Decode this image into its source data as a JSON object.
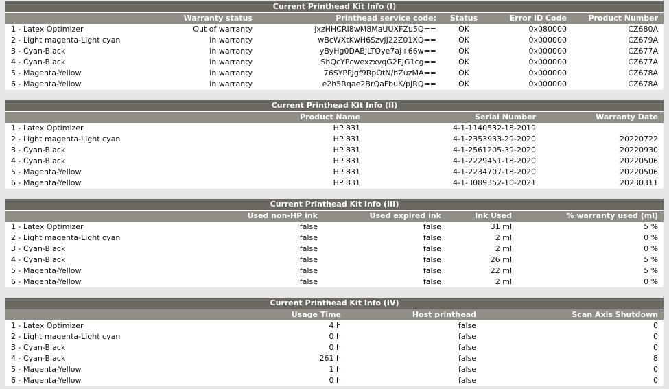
{
  "kit1": {
    "title": "Current Printhead Kit Info (I)",
    "headers": [
      "",
      "Warranty status",
      "Printhead service code:",
      "Status",
      "Error ID Code",
      "Product Number"
    ],
    "rows": [
      [
        "1 - Latex Optimizer",
        "Out of warranty",
        "jxzHHCRI8wM8MaUUXFZu5Q==",
        "OK",
        "0x080000",
        "CZ680A"
      ],
      [
        "2 - Light magenta-Light cyan",
        "In warranty",
        "wBcWXtKwH6SzvJJ22Z01XQ==",
        "OK",
        "0x000000",
        "CZ679A"
      ],
      [
        "3 - Cyan-Black",
        "In warranty",
        "yByHg0DABJLTOye7aJ+66w==",
        "OK",
        "0x000000",
        "CZ677A"
      ],
      [
        "4 - Cyan-Black",
        "In warranty",
        "ShQcYPcwexzxvqG2EJG1cg==",
        "OK",
        "0x000000",
        "CZ677A"
      ],
      [
        "5 - Magenta-Yellow",
        "In warranty",
        "76SYPPJgf9RpOtN/hZuzMA==",
        "OK",
        "0x000000",
        "CZ678A"
      ],
      [
        "6 - Magenta-Yellow",
        "In warranty",
        "e2h5Rqae2BrQaFbuK/pJRQ==",
        "OK",
        "0x000000",
        "CZ678A"
      ]
    ]
  },
  "kit2": {
    "title": "Current Printhead Kit Info (II)",
    "headers": [
      "",
      "Product Name",
      "Serial Number",
      "Warranty Date"
    ],
    "rows": [
      [
        "1 - Latex Optimizer",
        "HP 831",
        "4-1-1140532-18-2019",
        ""
      ],
      [
        "2 - Light magenta-Light cyan",
        "HP 831",
        "4-1-2353933-29-2020",
        "20220722"
      ],
      [
        "3 - Cyan-Black",
        "HP 831",
        "4-1-2561205-39-2020",
        "20220930"
      ],
      [
        "4 - Cyan-Black",
        "HP 831",
        "4-1-2229451-18-2020",
        "20220506"
      ],
      [
        "5 - Magenta-Yellow",
        "HP 831",
        "4-1-2234707-18-2020",
        "20220506"
      ],
      [
        "6 - Magenta-Yellow",
        "HP 831",
        "4-1-3089352-10-2021",
        "20230311"
      ]
    ]
  },
  "kit3": {
    "title": "Current Printhead Kit Info (III)",
    "headers": [
      "",
      "Used non-HP ink",
      "Used expired ink",
      "Ink Used",
      "% warranty used (ml)"
    ],
    "rows": [
      [
        "1 - Latex Optimizer",
        "false",
        "false",
        "31 ml",
        "5 %"
      ],
      [
        "2 - Light magenta-Light cyan",
        "false",
        "false",
        "2 ml",
        "0 %"
      ],
      [
        "3 - Cyan-Black",
        "false",
        "false",
        "2 ml",
        "0 %"
      ],
      [
        "4 - Cyan-Black",
        "false",
        "false",
        "26 ml",
        "5 %"
      ],
      [
        "5 - Magenta-Yellow",
        "false",
        "false",
        "22 ml",
        "5 %"
      ],
      [
        "6 - Magenta-Yellow",
        "false",
        "false",
        "2 ml",
        "0 %"
      ]
    ]
  },
  "kit4": {
    "title": "Current Printhead Kit Info (IV)",
    "headers": [
      "",
      "Usage Time",
      "Host printhead",
      "Scan Axis Shutdown"
    ],
    "rows": [
      [
        "1 - Latex Optimizer",
        "4 h",
        "false",
        "0"
      ],
      [
        "2 - Light magenta-Light cyan",
        "0 h",
        "false",
        "0"
      ],
      [
        "3 - Cyan-Black",
        "0 h",
        "false",
        "0"
      ],
      [
        "4 - Cyan-Black",
        "261 h",
        "false",
        "8"
      ],
      [
        "5 - Magenta-Yellow",
        "1 h",
        "false",
        "0"
      ],
      [
        "6 - Magenta-Yellow",
        "0 h",
        "false",
        "0"
      ]
    ]
  },
  "colors": {
    "title_bar": "#6b6861",
    "header_bar": "#908e87",
    "row_bg": "#ffffff",
    "page_bg": "#e6e6e6"
  }
}
